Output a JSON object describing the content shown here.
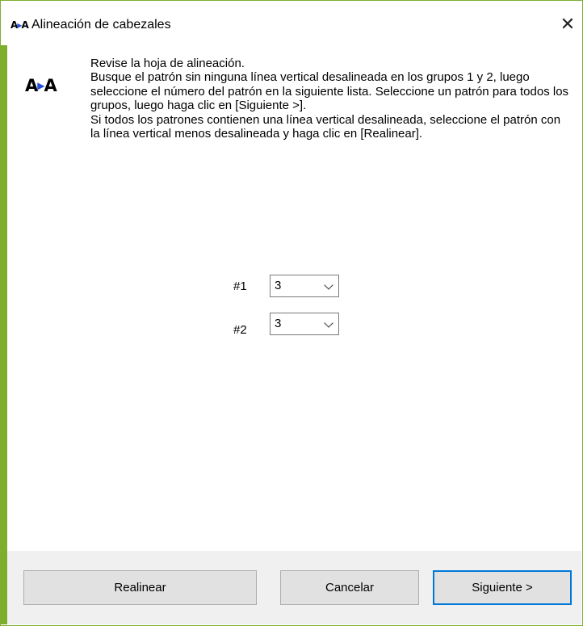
{
  "window": {
    "title": "Alineación de cabezales",
    "icon": "head-alignment-icon",
    "close_icon": "close-icon"
  },
  "instructions": {
    "line1": "Revise la hoja de alineación.",
    "line2": "Busque el patrón sin ninguna línea vertical desalineada en los grupos 1 y 2, luego seleccione el número del patrón en la siguiente lista. Seleccione un patrón para todos los grupos, luego haga clic en [Siguiente >].",
    "line3": "Si todos los patrones contienen una línea vertical desalineada, seleccione el patrón con la línea vertical menos desalineada y haga clic en [Realinear]."
  },
  "groups": [
    {
      "label": "#1",
      "selected": "3"
    },
    {
      "label": "#2",
      "selected": "3"
    }
  ],
  "buttons": {
    "realign": "Realinear",
    "cancel": "Cancelar",
    "next": "Siguiente >"
  },
  "colors": {
    "window_border": "#7fae2e",
    "footer_bg": "#f0f0f0",
    "button_bg": "#e1e1e1",
    "default_button_border": "#0078d7",
    "icon_arrow": "#1f4fd6"
  }
}
